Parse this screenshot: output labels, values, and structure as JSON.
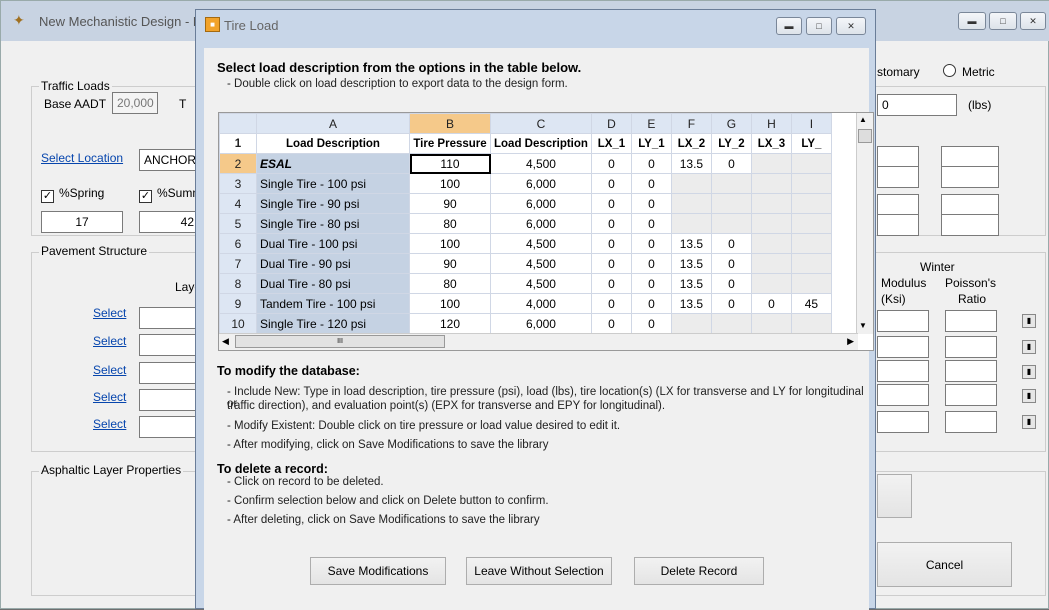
{
  "background_window": {
    "title": "New Mechanistic Design - Pro",
    "customary_label": "stomary",
    "metric_label": "Metric",
    "lbs_value": "0",
    "lbs_unit": "(lbs)",
    "traffic_loads_label": "Traffic Loads",
    "base_aadt_label": "Base AADT",
    "base_aadt_value": "20,000",
    "t_label": "T",
    "select_location_label": "Select Location",
    "location_value": "ANCHORA",
    "spring_label": "%Spring",
    "summer_label": "%Summ",
    "spring_value": "17",
    "summer_value": "42",
    "pavement_structure_label": "Pavement Structure",
    "layer_label": "Laye",
    "select_links": [
      "Select",
      "Select",
      "Select",
      "Select",
      "Select"
    ],
    "winter_label": "Winter",
    "modulus_label": "Modulus",
    "ksi_label": "(Ksi)",
    "poissons_label": "Poisson's",
    "ratio_label": "Ratio",
    "asphaltic_label": "Asphaltic Layer Properties",
    "cancel_label": "Cancel"
  },
  "dialog": {
    "title": "Tire Load",
    "heading": "Select load description from the options in the table below.",
    "subtext": "- Double click on load description to export data to the design form.",
    "grid": {
      "columns": [
        "A",
        "B",
        "C",
        "D",
        "E",
        "F",
        "G",
        "H",
        "I"
      ],
      "header_row": [
        "Load Description",
        "Tire Pressure",
        "Load Description",
        "LX_1",
        "LY_1",
        "LX_2",
        "LY_2",
        "LX_3",
        "LY_"
      ],
      "rows": [
        {
          "n": "2",
          "cells": [
            "ESAL",
            "110",
            "4,500",
            "0",
            "0",
            "13.5",
            "0",
            "",
            ""
          ]
        },
        {
          "n": "3",
          "cells": [
            "Single Tire - 100 psi",
            "100",
            "6,000",
            "0",
            "0",
            "",
            "",
            "",
            ""
          ]
        },
        {
          "n": "4",
          "cells": [
            "Single Tire - 90 psi",
            "90",
            "6,000",
            "0",
            "0",
            "",
            "",
            "",
            ""
          ]
        },
        {
          "n": "5",
          "cells": [
            "Single Tire - 80 psi",
            "80",
            "6,000",
            "0",
            "0",
            "",
            "",
            "",
            ""
          ]
        },
        {
          "n": "6",
          "cells": [
            "Dual Tire - 100 psi",
            "100",
            "4,500",
            "0",
            "0",
            "13.5",
            "0",
            "",
            ""
          ]
        },
        {
          "n": "7",
          "cells": [
            "Dual Tire - 90 psi",
            "90",
            "4,500",
            "0",
            "0",
            "13.5",
            "0",
            "",
            ""
          ]
        },
        {
          "n": "8",
          "cells": [
            "Dual Tire - 80 psi",
            "80",
            "4,500",
            "0",
            "0",
            "13.5",
            "0",
            "",
            ""
          ]
        },
        {
          "n": "9",
          "cells": [
            "Tandem Tire - 100 psi",
            "100",
            "4,000",
            "0",
            "0",
            "13.5",
            "0",
            "0",
            "45"
          ]
        },
        {
          "n": "10",
          "cells": [
            "Single Tire - 120 psi",
            "120",
            "6,000",
            "0",
            "0",
            "",
            "",
            "",
            ""
          ]
        }
      ],
      "header_row_number": "1",
      "hscroll_grip": "III"
    },
    "modify_heading": "To modify the database:",
    "modify_lines": [
      "- Include New: Type in load description, tire pressure (psi), load (lbs), tire location(s) (LX for transverse and LY for longitudinal or",
      "traffic direction), and evaluation point(s) (EPX for transverse and EPY for longitudinal).",
      "- Modify Existent: Double click on tire pressure or load value desired to edit it.",
      "- After modifying, click on Save Modifications to save the library"
    ],
    "delete_heading": "To delete a record:",
    "delete_lines": [
      "- Click on record to be deleted.",
      "- Confirm selection below and click on Delete button to confirm.",
      "- After deleting, click on Save Modifications to save the library"
    ],
    "buttons": {
      "save": "Save Modifications",
      "leave": "Leave Without Selection",
      "delete": "Delete Record"
    }
  }
}
